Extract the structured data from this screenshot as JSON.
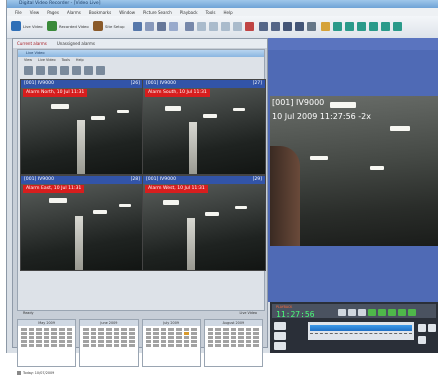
{
  "app": {
    "title": "Digital Video Recorder - [Video Live]"
  },
  "menu": [
    "File",
    "View",
    "Pages",
    "Alarms",
    "Bookmarks",
    "Window",
    "Picture Search",
    "Playback",
    "Tools",
    "Help"
  ],
  "toolbar": {
    "buttons": [
      {
        "label": "Live Video",
        "icon": "camera-icon"
      },
      {
        "label": "Recorded Video",
        "icon": "tape-icon"
      },
      {
        "label": "Site Setup",
        "icon": "setup-icon"
      }
    ]
  },
  "doc_tabs": [
    {
      "label": "Current alarms"
    },
    {
      "label": "Unassigned alarms"
    }
  ],
  "inner": {
    "title": "Live Video",
    "menu": [
      "View",
      "Live Video",
      "Tools",
      "Help"
    ]
  },
  "cameras": [
    {
      "name": "[001] IV9000",
      "count": "[26]",
      "alarm": "Alarm North, 10 Jul 11:31"
    },
    {
      "name": "[001] IV9000",
      "count": "[27]",
      "alarm": "Alarm South, 10 Jul 11:31"
    },
    {
      "name": "[001] IV9000",
      "count": "[28]",
      "alarm": "Alarm East, 10 Jul 11:31"
    },
    {
      "name": "[001] IV9000",
      "count": "[29]",
      "alarm": "Alarm West, 10 Jul 11:31"
    }
  ],
  "status": {
    "left": "Ready",
    "right": "Live Video"
  },
  "calendars": [
    {
      "month": "May 2009"
    },
    {
      "month": "June 2009"
    },
    {
      "month": "July 2009"
    },
    {
      "month": "August 2009"
    }
  ],
  "footer": {
    "today": "Today: 10/07/2009"
  },
  "viewer": {
    "camera_name": "[001] IV9000",
    "timestamp": "10 Jul 2009 11:27:56 -2x"
  },
  "playback": {
    "mode_label": "PLAYBACK",
    "clock": "11:27:56"
  },
  "colors": {
    "alarm_red": "#d71e1e",
    "header_blue": "#3254a8",
    "viewer_bg": "#4f6ab5",
    "clock_green": "#4aff7a"
  }
}
